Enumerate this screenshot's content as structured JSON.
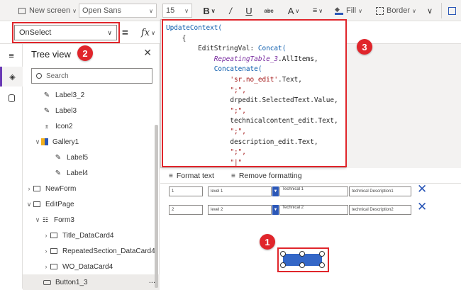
{
  "toolbar": {
    "new_screen": "New screen",
    "font": "Open Sans",
    "font_size": "15",
    "bold": "B",
    "italic": "/",
    "underline": "U",
    "strike": "abc",
    "font_color": "A",
    "fill": "Fill",
    "border": "Border"
  },
  "formula": {
    "property": "OnSelect",
    "equals": "=",
    "fx": "fx"
  },
  "tree": {
    "title": "Tree view",
    "search_placeholder": "Search",
    "items": [
      {
        "label": "Label3_2",
        "icon": "label-icon"
      },
      {
        "label": "Label3",
        "icon": "label-icon"
      },
      {
        "label": "Icon2",
        "icon": "icon-icon"
      },
      {
        "label": "Gallery1",
        "icon": "gallery-icon"
      },
      {
        "label": "Label5",
        "icon": "label-icon"
      },
      {
        "label": "Label4",
        "icon": "label-icon"
      },
      {
        "label": "NewForm",
        "icon": "screen-icon"
      },
      {
        "label": "EditPage",
        "icon": "screen-icon"
      },
      {
        "label": "Form3",
        "icon": "form-icon"
      },
      {
        "label": "Title_DataCard4",
        "icon": "card-icon"
      },
      {
        "label": "RepeatedSection_DataCard4",
        "icon": "card-icon"
      },
      {
        "label": "WO_DataCard4",
        "icon": "card-icon"
      },
      {
        "label": "Button1_3",
        "icon": "button-icon"
      }
    ],
    "more": "..."
  },
  "code": {
    "l1_fn": "UpdateContext(",
    "l2": "    {",
    "l3_key": "        EditStringVal: ",
    "l3_fn": "Concat(",
    "l4_ref": "RepeatingTable_3",
    "l4_rest": ".AllItems,",
    "l5_fn": "Concatenate(",
    "l6_str": "'sr.no_edit'",
    "l6_rest": ".Text,",
    "l7_str": "\";\",",
    "l8": "drpedit.SelectedText.Value,",
    "l9_str": "\";\",",
    "l10": "technicalcontent_edit.Text,",
    "l11_str": "\";\",",
    "l12": "description_edit.Text,",
    "l13_str": "\";\",",
    "l14_str": "\"|\"",
    "l15": "),"
  },
  "format_bar": {
    "format_text": "Format text",
    "remove_formatting": "Remove formatting"
  },
  "gallery": {
    "rows": [
      {
        "num": "1",
        "level": "level 1",
        "tech": "Technical 1",
        "desc": "technical Description1"
      },
      {
        "num": "2",
        "level": "level 2",
        "tech": "Technical 2",
        "desc": "technical Description2"
      }
    ]
  },
  "badges": {
    "one": "1",
    "two": "2",
    "three": "3"
  },
  "colors": {
    "annotation": "#e0252b",
    "accent": "#2b57b7",
    "button": "#3467c7"
  }
}
